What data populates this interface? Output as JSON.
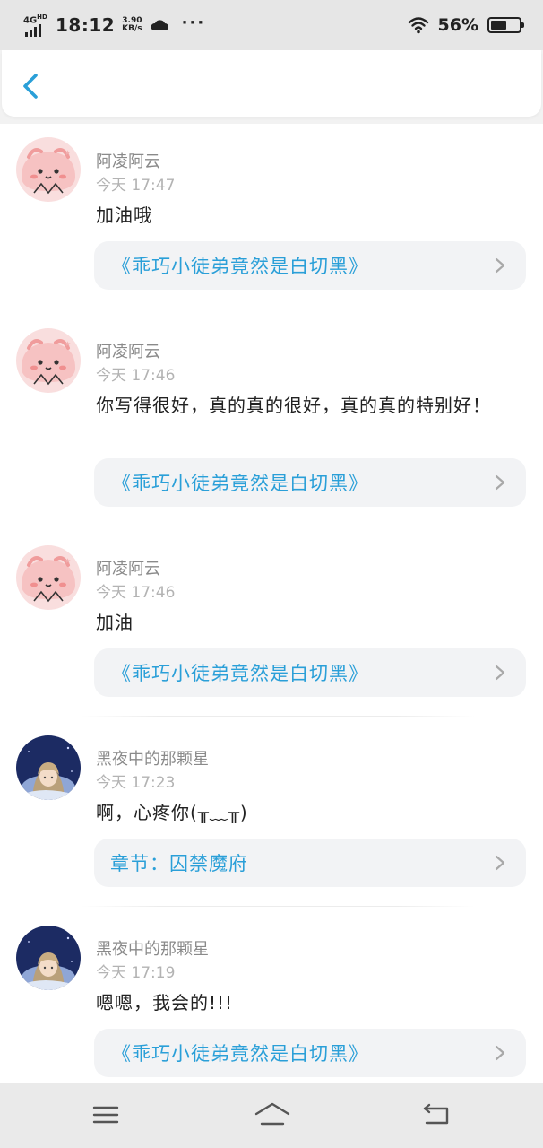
{
  "status_bar": {
    "network": "4G",
    "network_sup": "HD",
    "time": "18:12",
    "speed_value": "3.90",
    "speed_unit": "KB/s",
    "more": "···",
    "battery_percent": "56%",
    "battery_level": 0.56
  },
  "comments": [
    {
      "username": "阿凌阿云",
      "time": "今天 17:47",
      "text": "加油哦",
      "ref": "《乖巧小徒弟竟然是白切黑》",
      "avatar": "pink-blob-avatar"
    },
    {
      "username": "阿凌阿云",
      "time": "今天 17:46",
      "text": "你写得很好，真的真的很好，真的真的特别好！",
      "ref": "《乖巧小徒弟竟然是白切黑》",
      "avatar": "pink-blob-avatar"
    },
    {
      "username": "阿凌阿云",
      "time": "今天 17:46",
      "text": "加油",
      "ref": "《乖巧小徒弟竟然是白切黑》",
      "avatar": "pink-blob-avatar"
    },
    {
      "username": "黑夜中的那颗星",
      "time": "今天 17:23",
      "text": "啊，心疼你(╥﹏╥)",
      "ref": "章节：囚禁魔府",
      "avatar": "anime-girl-avatar"
    },
    {
      "username": "黑夜中的那颗星",
      "time": "今天 17:19",
      "text": "嗯嗯，我会的!!!",
      "ref": "《乖巧小徒弟竟然是白切黑》",
      "avatar": "anime-girl-avatar"
    }
  ],
  "icons": {
    "back": "chevron-left-icon",
    "menu": "menu-icon",
    "home": "home-icon",
    "return": "return-icon",
    "chevron": "chevron-right-icon"
  },
  "colors": {
    "accent": "#2a9fd8",
    "card_bg": "#f2f3f5",
    "pink_avatar": "#f6c9c9",
    "dark_avatar": "#1c2b63"
  }
}
